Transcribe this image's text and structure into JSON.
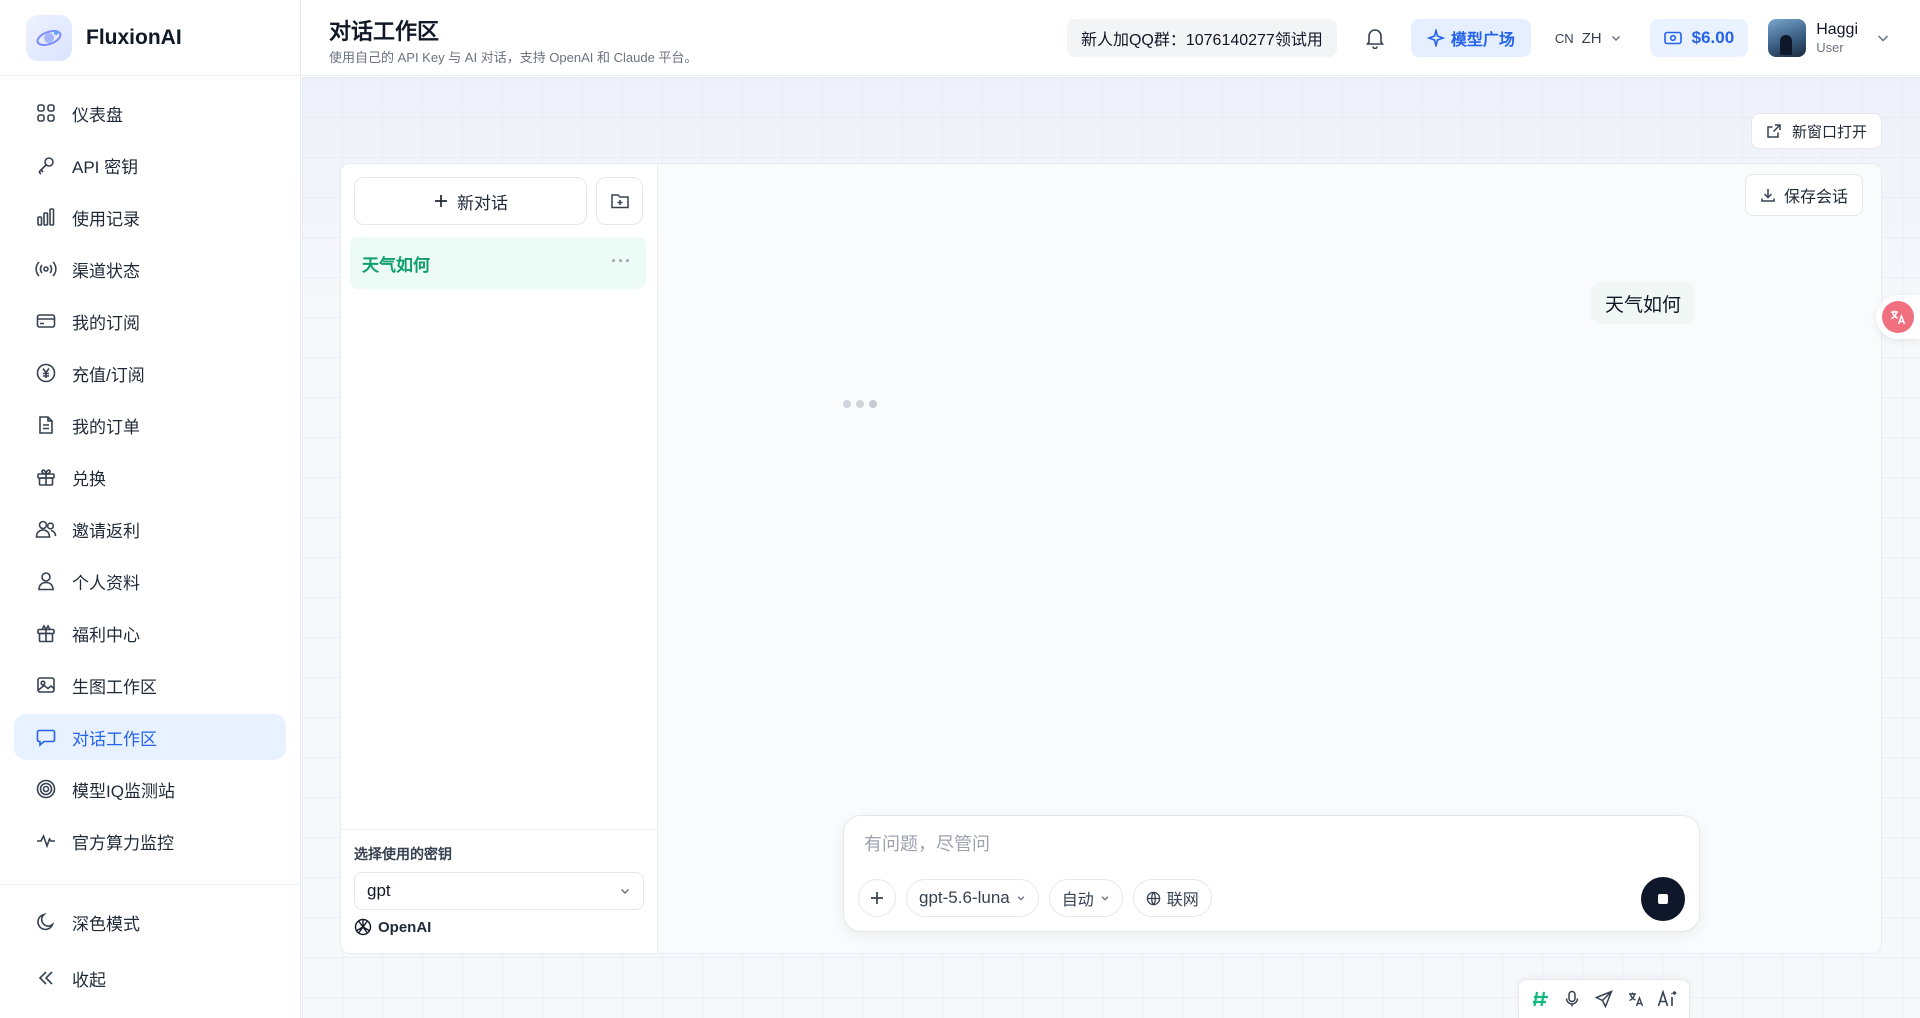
{
  "brand": {
    "name": "FluxionAI"
  },
  "sidebar": {
    "items": [
      {
        "label": "仪表盘",
        "icon": "grid-icon"
      },
      {
        "label": "API 密钥",
        "icon": "key-icon"
      },
      {
        "label": "使用记录",
        "icon": "bar-chart-icon"
      },
      {
        "label": "渠道状态",
        "icon": "broadcast-icon"
      },
      {
        "label": "我的订阅",
        "icon": "credit-card-icon"
      },
      {
        "label": "充值/订阅",
        "icon": "yen-circle-icon"
      },
      {
        "label": "我的订单",
        "icon": "document-icon"
      },
      {
        "label": "兑换",
        "icon": "gift-icon"
      },
      {
        "label": "邀请返利",
        "icon": "users-icon"
      },
      {
        "label": "个人资料",
        "icon": "user-icon"
      },
      {
        "label": "福利中心",
        "icon": "gift-box-icon"
      },
      {
        "label": "生图工作区",
        "icon": "image-icon"
      },
      {
        "label": "对话工作区",
        "icon": "chat-bubble-icon"
      },
      {
        "label": "模型IQ监测站",
        "icon": "target-icon"
      },
      {
        "label": "官方算力监控",
        "icon": "pulse-icon"
      }
    ],
    "active_index": 12,
    "dark_mode_label": "深色模式",
    "collapse_label": "收起"
  },
  "header": {
    "title": "对话工作区",
    "subtitle": "使用自己的 API Key 与 AI 对话，支持 OpenAI 和 Claude 平台。",
    "qq_group": "新人加QQ群：1076140277领试用",
    "model_plaza": "模型广场",
    "lang_code": "CN",
    "lang": "ZH",
    "balance": "$6.00",
    "user_name": "Haggi",
    "user_role": "User"
  },
  "main": {
    "new_window_label": "新窗口打开",
    "save_session_label": "保存会话",
    "new_chat_label": "新对话",
    "conversations": [
      {
        "title": "天气如何"
      }
    ],
    "key_select_label": "选择使用的密钥",
    "key_select_value": "gpt",
    "provider": "OpenAI",
    "messages": [
      {
        "role": "user",
        "text": "天气如何"
      }
    ],
    "composer": {
      "placeholder": "有问题，尽管问",
      "model": "gpt-5.6-luna",
      "mode": "自动",
      "web_search": "联网"
    }
  },
  "colors": {
    "accent": "#2563eb",
    "active_conversation": "#0f9f6e",
    "stop_button": "#0f172a"
  }
}
